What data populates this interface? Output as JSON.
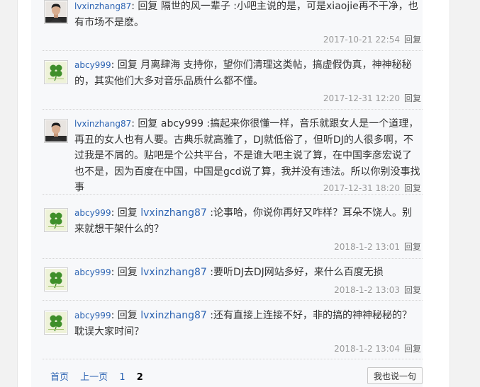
{
  "replies": [
    {
      "user": "lvxinzhang87",
      "avatar": "man-avatar",
      "prefix": ": 回复 ",
      "target": "隔世的风一辈子",
      "target_is_link": false,
      "text": " :小吧主说的是，可是xiaojie再不干净，也有市场不是麽。",
      "time": "2017-10-21 22:54",
      "reply_label": "回复"
    },
    {
      "user": "abcy999",
      "avatar": "clover-avatar",
      "prefix": ": 回复 ",
      "target": "月离肆海",
      "target_is_link": false,
      "text": " 支持你，望你们清理这类帖，搞虚假伪真，神神秘秘的，其实他们大多对音乐品质什么都不懂。",
      "time": "2017-12-31 12:20",
      "reply_label": "回复"
    },
    {
      "user": "lvxinzhang87",
      "avatar": "man-avatar",
      "prefix": ": 回复 ",
      "target": "abcy999",
      "target_is_link": false,
      "text": " :搞起来你很懂一样，音乐就跟女人是一个道理，再丑的女人也有人要。古典乐就高雅了，DJ就低俗了，但听DJ的人很多啊，不过我是不屑的。贴吧是个公共平台，不是谁大吧主说了算，在中国李彦宏说了也不是，因为百度在中国，中国是gcd说了算，我并没有违法。所以你别没事找事",
      "time": "2017-12-31 18:20",
      "reply_label": "回复"
    },
    {
      "user": "abcy999",
      "avatar": "clover-avatar",
      "prefix": ": 回复 ",
      "target": "lvxinzhang87",
      "target_is_link": true,
      "text": " :论事哈，你说你再好又咋样？耳朵不饶人。别来就想干架什么的？",
      "time": "2018-1-2 13:01",
      "reply_label": "回复"
    },
    {
      "user": "abcy999",
      "avatar": "clover-avatar",
      "prefix": ": 回复 ",
      "target": "lvxinzhang87",
      "target_is_link": true,
      "text": " :要听DJ去DJ网站多好，来什么百度无损",
      "time": "2018-1-2 13:03",
      "reply_label": "回复"
    },
    {
      "user": "abcy999",
      "avatar": "clover-avatar",
      "prefix": ": 回复 ",
      "target": "lvxinzhang87",
      "target_is_link": true,
      "text": " :还有直接上连接不好，非的搞的神神秘秘的？耽误大家时间？",
      "time": "2018-1-2 13:04",
      "reply_label": "回复"
    }
  ],
  "pagination": {
    "first": "首页",
    "prev": "上一页",
    "pages": [
      "1",
      "2"
    ],
    "current": "2"
  },
  "say_button": "我也说一句",
  "colors": {
    "link": "#2d64b3",
    "meta": "#999999",
    "background": "#f7f8fa"
  }
}
